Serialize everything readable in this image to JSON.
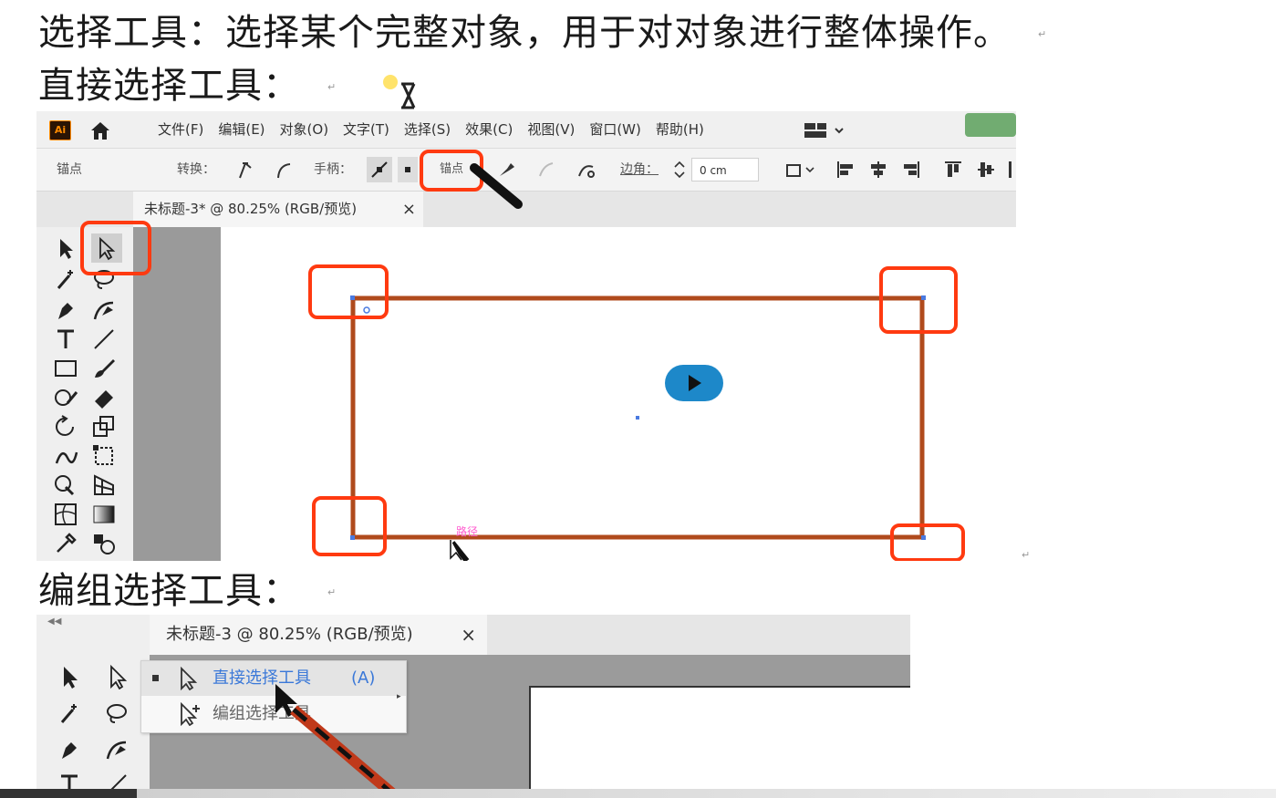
{
  "headings": {
    "line1": "选择工具：选择某个完整对象，用于对对象进行整体操作。",
    "line2": "直接选择工具：",
    "line3": "编组选择工具："
  },
  "paragraph_mark": "↵",
  "screenshot1": {
    "app_logo": "Ai",
    "menu": [
      "文件(F)",
      "编辑(E)",
      "对象(O)",
      "文字(T)",
      "选择(S)",
      "效果(C)",
      "视图(V)",
      "窗口(W)",
      "帮助(H)"
    ],
    "control_bar": {
      "anchor_label": "锚点",
      "convert_label": "转换：",
      "handle_label": "手柄：",
      "anchor_button": "锚点",
      "corner_label": "边角：",
      "corner_value": "0 cm"
    },
    "tab": {
      "title": "未标题-3* @ 80.25% (RGB/预览)",
      "close": "×"
    },
    "path_label": "路径",
    "highlight_color": "#ff3a10",
    "rect_stroke_color": "#b04a1c"
  },
  "screenshot2": {
    "tab": {
      "title": "未标题-3 @ 80.25% (RGB/预览)",
      "close": "×"
    },
    "flyout": [
      {
        "label": "直接选择工具",
        "shortcut": "(A)",
        "selected": true
      },
      {
        "label": "编组选择工具",
        "shortcut": "",
        "selected": false
      }
    ]
  }
}
